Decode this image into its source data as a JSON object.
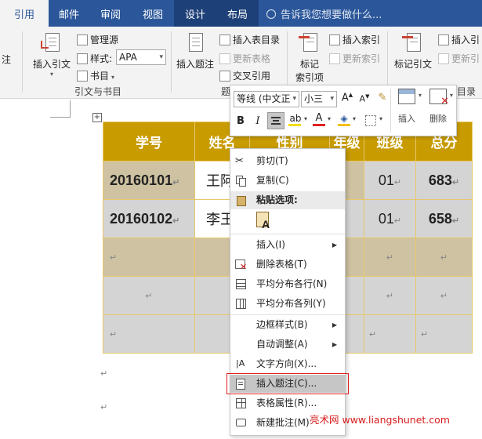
{
  "tabs": [
    "引用",
    "邮件",
    "审阅",
    "视图",
    "设计",
    "布局"
  ],
  "tell_me": "告诉我您想要做什么...",
  "ribbon": {
    "partial_left": "注",
    "insert_citation": "插入引文",
    "manage_sources": "管理源",
    "style_label": "样式:",
    "style_value": "APA",
    "bibliography": "书目",
    "group_citations": "引文与书目",
    "insert_caption": "插入题注",
    "insert_table_of_figures": "插入表目录",
    "update_table": "更新表格",
    "cross_reference": "交叉引用",
    "group_captions_partial": "题",
    "mark_entry_line1": "标记",
    "mark_entry_line2": "索引项",
    "insert_index": "插入索引",
    "update_index": "更新索引",
    "mark_citation": "标记引文",
    "insert_toa_partial": "插入引",
    "update_toa_partial": "更新引",
    "group_toa_partial": "目录"
  },
  "minibar": {
    "font": "等线 (中文正",
    "size": "小三",
    "bold": "B",
    "italic": "I",
    "insert": "插入",
    "delete": "删除"
  },
  "table": {
    "headers": [
      "学号",
      "姓名",
      "性别",
      "年级",
      "班级",
      "总分"
    ],
    "rows": [
      [
        "20160101",
        "王阿",
        "",
        "",
        "01",
        "683"
      ],
      [
        "20160102",
        "李王",
        "",
        "",
        "01",
        "658"
      ]
    ]
  },
  "context_menu": {
    "cut": "剪切(T)",
    "copy": "复制(C)",
    "paste_options": "粘贴选项:",
    "insert": "插入(I)",
    "delete_table": "删除表格(T)",
    "distribute_rows": "平均分布各行(N)",
    "distribute_cols": "平均分布各列(Y)",
    "border_styles": "边框样式(B)",
    "autofit": "自动调整(A)",
    "text_direction": "文字方向(X)...",
    "insert_caption": "插入题注(C)...",
    "table_properties": "表格属性(R)...",
    "new_comment": "新建批注(M)"
  },
  "watermark": "亮术网 www.liangshunet.com",
  "para_mark": "↵",
  "colors": {
    "tab_bar": "#2b579a",
    "table_header": "#c89b00",
    "highlight_outline": "#e02020"
  }
}
